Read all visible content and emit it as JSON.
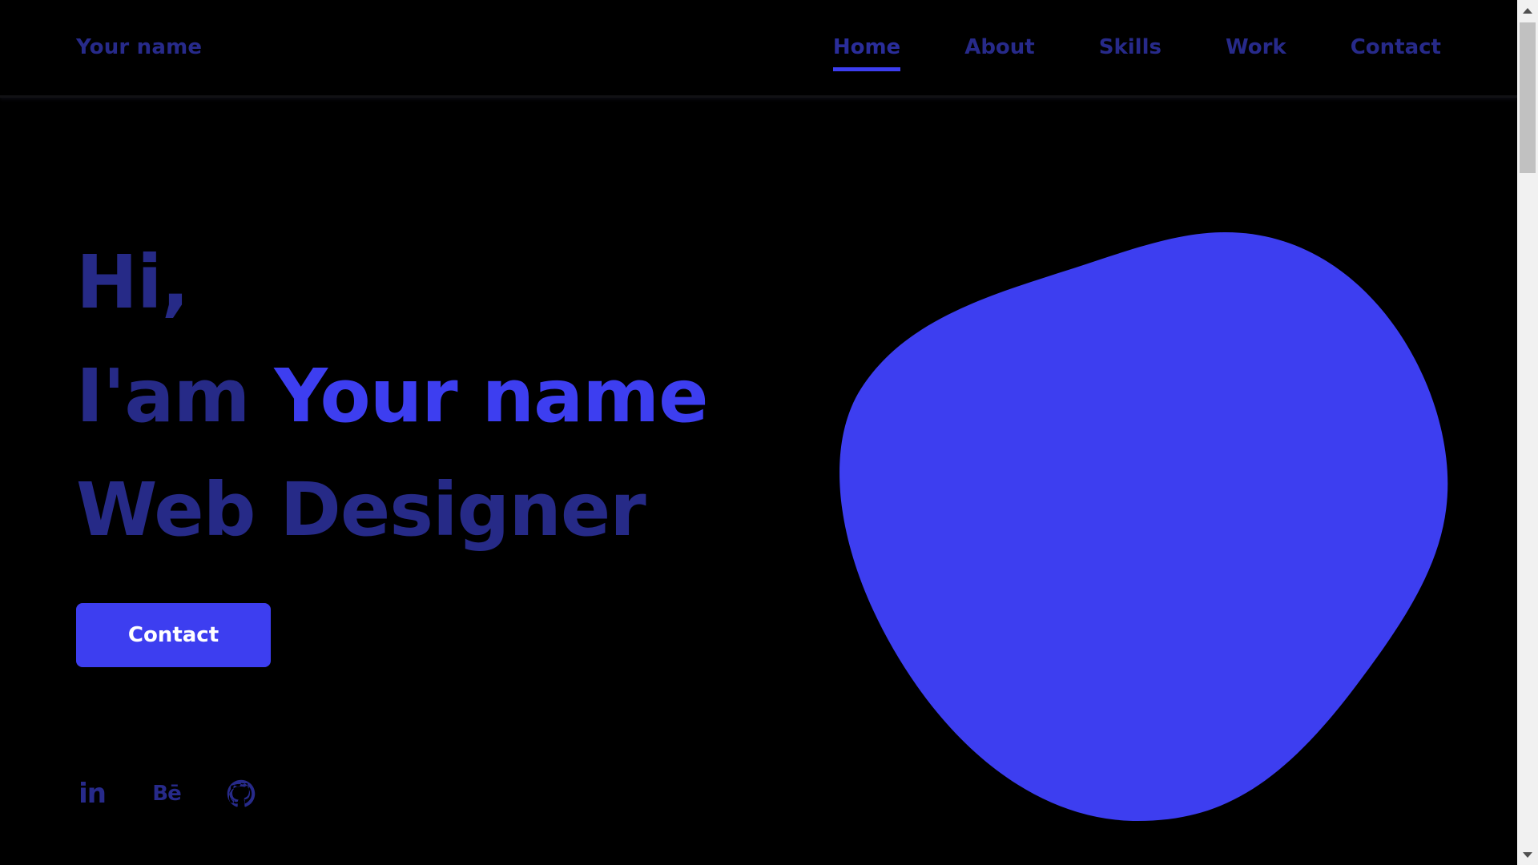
{
  "header": {
    "logo": "Your name",
    "nav": [
      {
        "label": "Home",
        "active": true
      },
      {
        "label": "About",
        "active": false
      },
      {
        "label": "Skills",
        "active": false
      },
      {
        "label": "Work",
        "active": false
      },
      {
        "label": "Contact",
        "active": false
      }
    ]
  },
  "hero": {
    "line1": "Hi,",
    "line2_prefix": "I'am ",
    "line2_name": "Your name",
    "line3": "Web Designer",
    "button_label": "Contact"
  },
  "socials": [
    {
      "icon": "linkedin-icon",
      "label": "in"
    },
    {
      "icon": "behance-icon",
      "label": "Bē"
    },
    {
      "icon": "github-icon"
    }
  ],
  "colors": {
    "background": "#000000",
    "accent": "#3d3ef0",
    "muted_text": "#272a8a",
    "button_text": "#ffffff"
  }
}
